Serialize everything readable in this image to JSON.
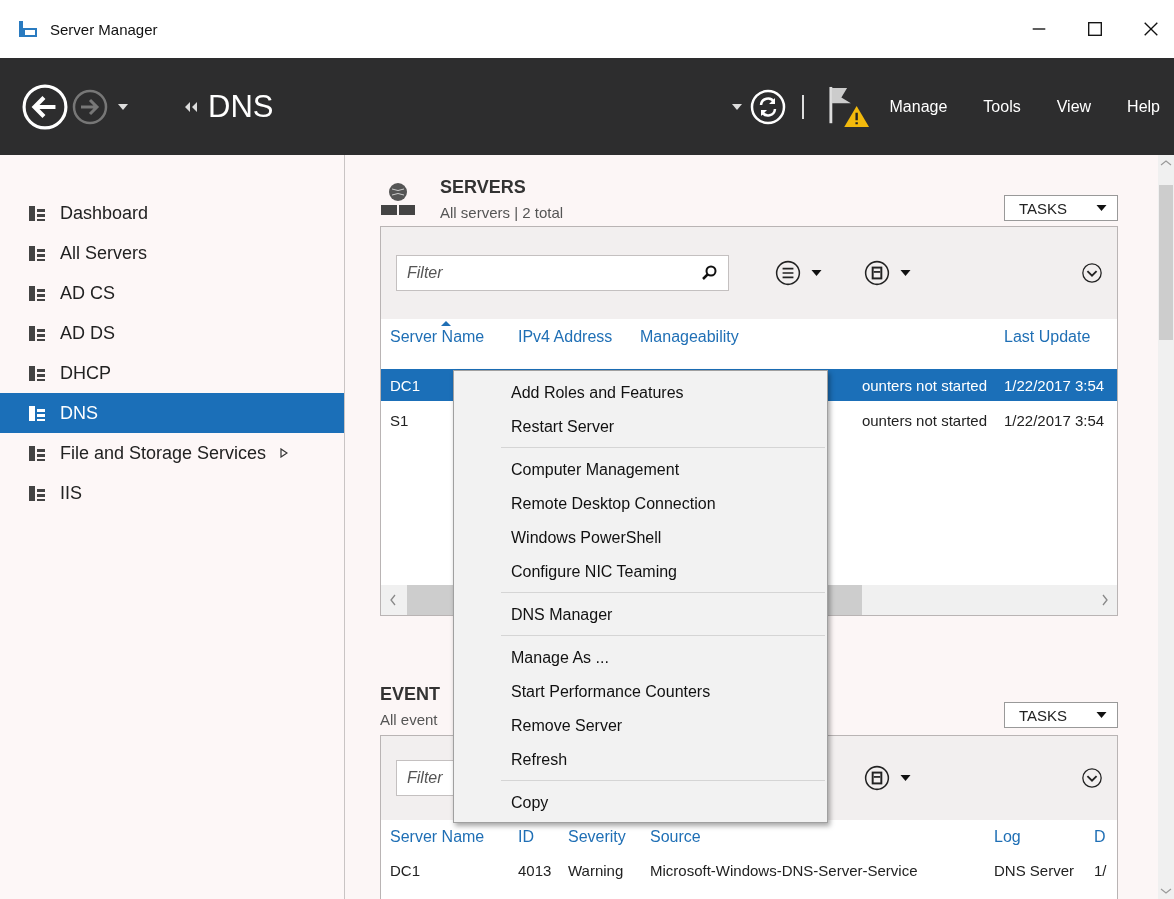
{
  "window": {
    "title": "Server Manager"
  },
  "toolbar": {
    "breadcrumb": "DNS",
    "menus": [
      "Manage",
      "Tools",
      "View",
      "Help"
    ],
    "forward_disabled": true,
    "warning": true
  },
  "sidebar": {
    "items": [
      {
        "label": "Dashboard",
        "selected": false,
        "submenu": false
      },
      {
        "label": "All Servers",
        "selected": false,
        "submenu": false
      },
      {
        "label": "AD CS",
        "selected": false,
        "submenu": false
      },
      {
        "label": "AD DS",
        "selected": false,
        "submenu": false
      },
      {
        "label": "DHCP",
        "selected": false,
        "submenu": false
      },
      {
        "label": "DNS",
        "selected": true,
        "submenu": false
      },
      {
        "label": "File and Storage Services",
        "selected": false,
        "submenu": true
      },
      {
        "label": "IIS",
        "selected": false,
        "submenu": false
      }
    ]
  },
  "servers": {
    "title": "SERVERS",
    "subtitle": "All servers | 2 total",
    "tasks": "TASKS",
    "filter": {
      "placeholder": "Filter"
    },
    "columns": [
      {
        "label": "Server Name",
        "sorted": true
      },
      {
        "label": "IPv4 Address",
        "sorted": false
      },
      {
        "label": "Manageability",
        "sorted": false
      },
      {
        "label": "Last Update",
        "sorted": false
      }
    ],
    "rows": [
      {
        "selected": true,
        "cells": [
          "DC1",
          "",
          "ounters not started",
          "1/22/2017 3:54"
        ]
      },
      {
        "selected": false,
        "cells": [
          "S1",
          "",
          "ounters not started",
          "1/22/2017 3:54"
        ]
      }
    ]
  },
  "events": {
    "title": "EVENT",
    "subtitle": "All event",
    "tasks": "TASKS",
    "filter": {
      "placeholder": "Filter"
    },
    "columns": [
      {
        "label": "Server Name"
      },
      {
        "label": "ID"
      },
      {
        "label": "Severity"
      },
      {
        "label": "Source"
      },
      {
        "label": "Log"
      },
      {
        "label": "D"
      }
    ],
    "rows": [
      {
        "cells": [
          "DC1",
          "4013",
          "Warning",
          "Microsoft-Windows-DNS-Server-Service",
          "DNS Server",
          "1/"
        ]
      }
    ]
  },
  "context_menu": {
    "items": [
      {
        "kind": "item",
        "label": "Add Roles and Features"
      },
      {
        "kind": "item",
        "label": "Restart Server"
      },
      {
        "kind": "separator"
      },
      {
        "kind": "item",
        "label": "Computer Management"
      },
      {
        "kind": "item",
        "label": "Remote Desktop Connection"
      },
      {
        "kind": "item",
        "label": "Windows PowerShell"
      },
      {
        "kind": "item",
        "label": "Configure NIC Teaming"
      },
      {
        "kind": "separator"
      },
      {
        "kind": "item",
        "label": "DNS Manager"
      },
      {
        "kind": "separator"
      },
      {
        "kind": "item",
        "label": "Manage As ..."
      },
      {
        "kind": "item",
        "label": "Start Performance Counters"
      },
      {
        "kind": "item",
        "label": "Remove Server"
      },
      {
        "kind": "item",
        "label": "Refresh"
      },
      {
        "kind": "separator"
      },
      {
        "kind": "item",
        "label": "Copy"
      }
    ]
  }
}
